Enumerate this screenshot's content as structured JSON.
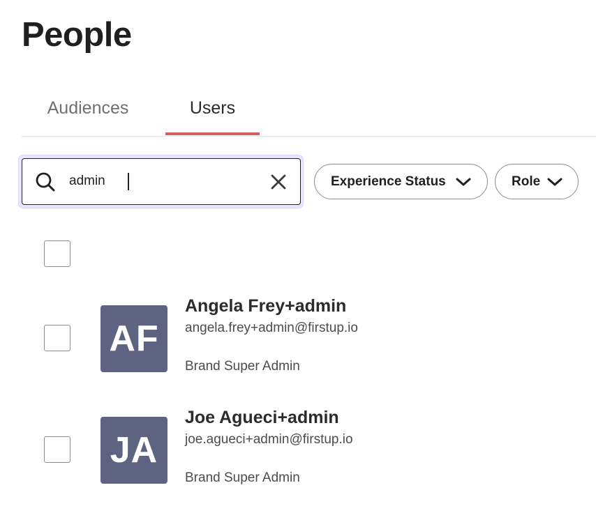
{
  "page": {
    "title": "People"
  },
  "tabs": [
    {
      "label": "Audiences",
      "active": false
    },
    {
      "label": "Users",
      "active": true
    }
  ],
  "search": {
    "value": "admin",
    "placeholder": ""
  },
  "filters": [
    {
      "label": "Experience Status",
      "icon": "chevron-down-icon"
    },
    {
      "label": "Role",
      "icon": "chevron-down-icon"
    }
  ],
  "users": [
    {
      "initials": "AF",
      "name": "Angela Frey+admin",
      "email": "angela.frey+admin@firstup.io",
      "role": "Brand Super Admin"
    },
    {
      "initials": "JA",
      "name": "Joe Agueci+admin",
      "email": "joe.agueci+admin@firstup.io",
      "role": "Brand Super Admin"
    }
  ],
  "colors": {
    "active_tab_underline": "#dd5a61",
    "avatar_background": "#5d6381",
    "search_focus_ring": "#ebe6ff"
  }
}
